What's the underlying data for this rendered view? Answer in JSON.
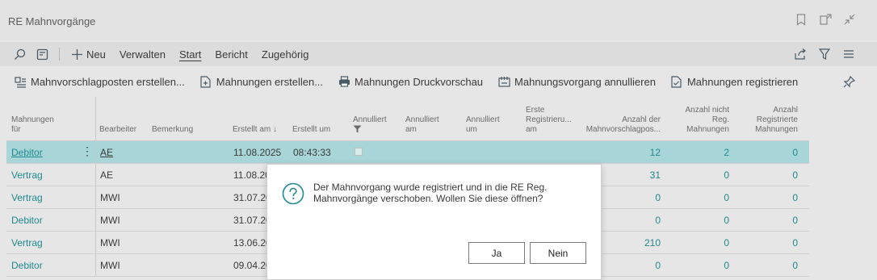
{
  "window": {
    "title": "RE Mahnvorgänge"
  },
  "actionbar": {
    "menu": [
      "Neu",
      "Verwalten",
      "Start",
      "Bericht",
      "Zugehörig"
    ],
    "active": "Start"
  },
  "promoted": [
    "Mahnvorschlagposten erstellen...",
    "Mahnungen erstellen...",
    "Mahnungen Druckvorschau",
    "Mahnungsvorgang annullieren",
    "Mahnungen registrieren"
  ],
  "columns": {
    "mahnungen_fuer": [
      "Mahnungen",
      "für"
    ],
    "bearbeiter": "Bearbeiter",
    "bemerkung": "Bemerkung",
    "erstellt_am": "Erstellt am ↓",
    "erstellt_um": "Erstellt um",
    "annulliert": "Annulliert",
    "annulliert_am": [
      "Annulliert",
      "am"
    ],
    "annulliert_um": [
      "Annulliert",
      "um"
    ],
    "erste_reg": [
      "Erste",
      "Registrieru...",
      "am"
    ],
    "anzahl_mvp": [
      "Anzahl der",
      "Mahnvorschlagpos..."
    ],
    "anzahl_nicht_reg": [
      "Anzahl nicht",
      "Reg.",
      "Mahnungen"
    ],
    "anzahl_reg": [
      "Anzahl",
      "Registrierte",
      "Mahnungen"
    ]
  },
  "rows": [
    {
      "fuer": "Debitor",
      "bearbeiter": "AE",
      "datum": "11.08.2025",
      "zeit": "08:43:33",
      "mvp": "12",
      "nicht_reg": "2",
      "reg": "0"
    },
    {
      "fuer": "Vertrag",
      "bearbeiter": "AE",
      "datum": "11.08.20",
      "zeit": "",
      "mvp": "31",
      "nicht_reg": "0",
      "reg": "0"
    },
    {
      "fuer": "Vertrag",
      "bearbeiter": "MWI",
      "datum": "31.07.20",
      "zeit": "",
      "mvp": "0",
      "nicht_reg": "0",
      "reg": "0"
    },
    {
      "fuer": "Debitor",
      "bearbeiter": "MWI",
      "datum": "31.07.20",
      "zeit": "",
      "mvp": "0",
      "nicht_reg": "0",
      "reg": "0"
    },
    {
      "fuer": "Vertrag",
      "bearbeiter": "MWI",
      "datum": "13.06.20",
      "zeit": "",
      "mvp": "210",
      "nicht_reg": "0",
      "reg": "0"
    },
    {
      "fuer": "Debitor",
      "bearbeiter": "MWI",
      "datum": "09.04.20",
      "zeit": "",
      "mvp": "0",
      "nicht_reg": "0",
      "reg": "0"
    }
  ],
  "dialog": {
    "line1": "Der Mahnvorgang wurde registriert und in die RE Reg.",
    "line2": "Mahnvorgänge verschoben. Wollen Sie diese öffnen?",
    "yes": "Ja",
    "no": "Nein"
  },
  "colors": {
    "accent": "#1f8a8f",
    "selected_row": "#a8d5d8"
  }
}
